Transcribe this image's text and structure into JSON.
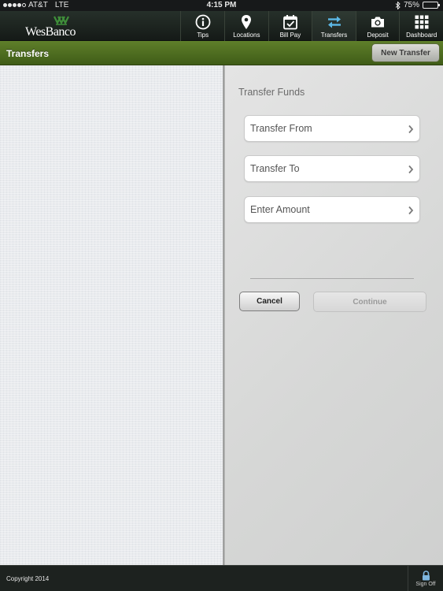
{
  "status_bar": {
    "carrier": "AT&T",
    "network": "LTE",
    "time": "4:15 PM",
    "battery": "75%",
    "battery_level": 0.75,
    "icons": [
      "signal-dots-icon",
      "bluetooth-icon",
      "battery-icon"
    ]
  },
  "brand": {
    "logo_text": "WesBanco",
    "logo_icon": "wesbanco-chevron-icon",
    "accent_color": "#3f8f3a"
  },
  "nav": {
    "items": [
      {
        "label": "Tips",
        "icon": "info-icon"
      },
      {
        "label": "Locations",
        "icon": "map-pin-icon"
      },
      {
        "label": "Bill Pay",
        "icon": "calendar-check-icon"
      },
      {
        "label": "Transfers",
        "icon": "transfer-arrows-icon",
        "active": true
      },
      {
        "label": "Deposit",
        "icon": "camera-icon"
      },
      {
        "label": "Dashboard",
        "icon": "grid-icon"
      }
    ]
  },
  "title_bar": {
    "title": "Transfers",
    "new_transfer_label": "New Transfer",
    "bar_color": "#4f6e20"
  },
  "form": {
    "section_title": "Transfer Funds",
    "fields": [
      {
        "label": "Transfer From",
        "icon": "chevron-right-icon"
      },
      {
        "label": "Transfer To",
        "icon": "chevron-right-icon"
      },
      {
        "label": "Enter Amount",
        "icon": "chevron-right-icon"
      }
    ],
    "cancel_label": "Cancel",
    "continue_label": "Continue"
  },
  "footer": {
    "copyright": "Copyright 2014",
    "sign_off_label": "Sign Off",
    "sign_off_icon": "lock-icon"
  }
}
